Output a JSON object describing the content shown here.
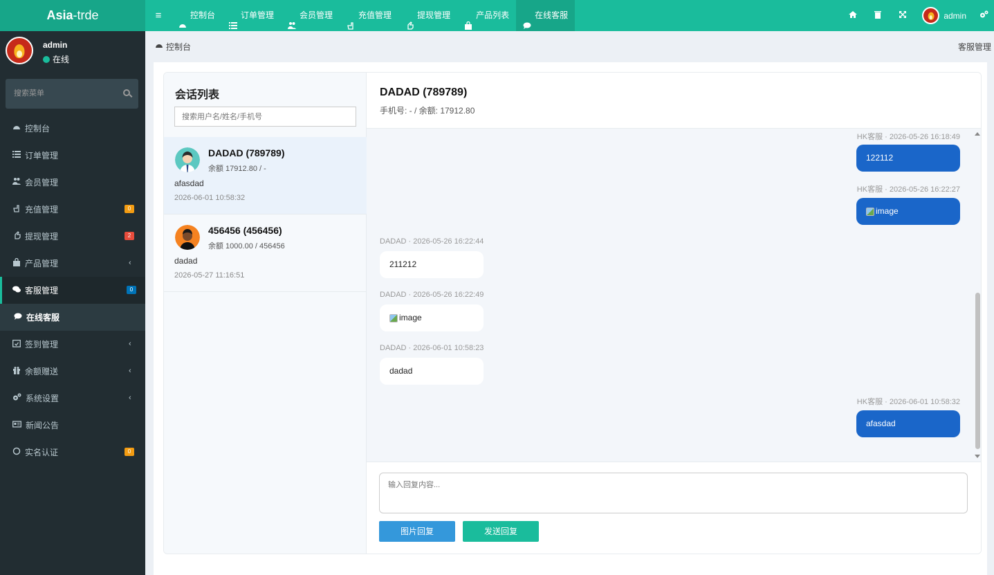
{
  "brand": {
    "bold": "Asia",
    "rest": "-trde"
  },
  "topnav": [
    {
      "label": "控制台",
      "icon": "dashboard-icon"
    },
    {
      "label": "订单管理",
      "icon": "list-icon"
    },
    {
      "label": "会员管理",
      "icon": "users-icon"
    },
    {
      "label": "充值管理",
      "icon": "hand-point-icon"
    },
    {
      "label": "提现管理",
      "icon": "hand-up-icon"
    },
    {
      "label": "产品列表",
      "icon": "shopping-bag-icon"
    },
    {
      "label": "在线客服",
      "icon": "chat-icon"
    }
  ],
  "topright": {
    "user": "admin"
  },
  "sidebar": {
    "user": {
      "name": "admin",
      "status": "在线"
    },
    "search_placeholder": "搜索菜单",
    "items": [
      {
        "label": "控制台",
        "icon": "dashboard-icon"
      },
      {
        "label": "订单管理",
        "icon": "list-icon"
      },
      {
        "label": "会员管理",
        "icon": "users-icon"
      },
      {
        "label": "充值管理",
        "icon": "hand-point-icon",
        "badge": "0",
        "badge_color": "#f39c12"
      },
      {
        "label": "提现管理",
        "icon": "hand-up-icon",
        "badge": "2",
        "badge_color": "#e74c3c"
      },
      {
        "label": "产品管理",
        "icon": "shopping-bag-icon",
        "caret": "‹"
      },
      {
        "label": "客服管理",
        "icon": "comments-icon",
        "badge": "0",
        "badge_color": "#0073b7"
      },
      {
        "label": "在线客服",
        "icon": "chat-icon"
      },
      {
        "label": "签到管理",
        "icon": "calendar-check-icon",
        "caret": "‹"
      },
      {
        "label": "余额赠送",
        "icon": "gift-icon",
        "caret": "‹"
      },
      {
        "label": "系统设置",
        "icon": "cogs-icon",
        "caret": "‹"
      },
      {
        "label": "新闻公告",
        "icon": "newspaper-icon"
      },
      {
        "label": "实名认证",
        "icon": "circle-icon",
        "badge": "0",
        "badge_color": "#f39c12"
      }
    ]
  },
  "breadcrumb": {
    "left": "控制台",
    "right": "客服管理"
  },
  "conversations": {
    "title": "会话列表",
    "search_placeholder": "搜索用户名/姓名/手机号",
    "items": [
      {
        "name": "DADAD (789789)",
        "balance": "余额 17912.80 / -",
        "last": "afasdad",
        "time": "2026-06-01 10:58:32"
      },
      {
        "name": "456456 (456456)",
        "balance": "余额 1000.00 / 456456",
        "last": "dadad",
        "time": "2026-05-27 11:16:51"
      }
    ]
  },
  "chat": {
    "name": "DADAD (789789)",
    "info": "手机号: - / 余额: 17912.80",
    "messages": [
      {
        "meta": "HK客服 · 2026-05-26 16:18:49",
        "text": "122112",
        "side": "mine"
      },
      {
        "meta": "HK客服 · 2026-05-26 16:22:27",
        "text": "image",
        "side": "mine",
        "image": true
      },
      {
        "meta": "DADAD · 2026-05-26 16:22:44",
        "text": "211212",
        "side": "theirs"
      },
      {
        "meta": "DADAD · 2026-05-26 16:22:49",
        "text": "image",
        "side": "theirs",
        "image": true
      },
      {
        "meta": "DADAD · 2026-06-01 10:58:23",
        "text": "dadad",
        "side": "theirs"
      },
      {
        "meta": "HK客服 · 2026-06-01 10:58:32",
        "text": "afasdad",
        "side": "mine"
      }
    ],
    "reply_placeholder": "输入回复内容...",
    "btn_image": "图片回复",
    "btn_send": "发送回复"
  }
}
